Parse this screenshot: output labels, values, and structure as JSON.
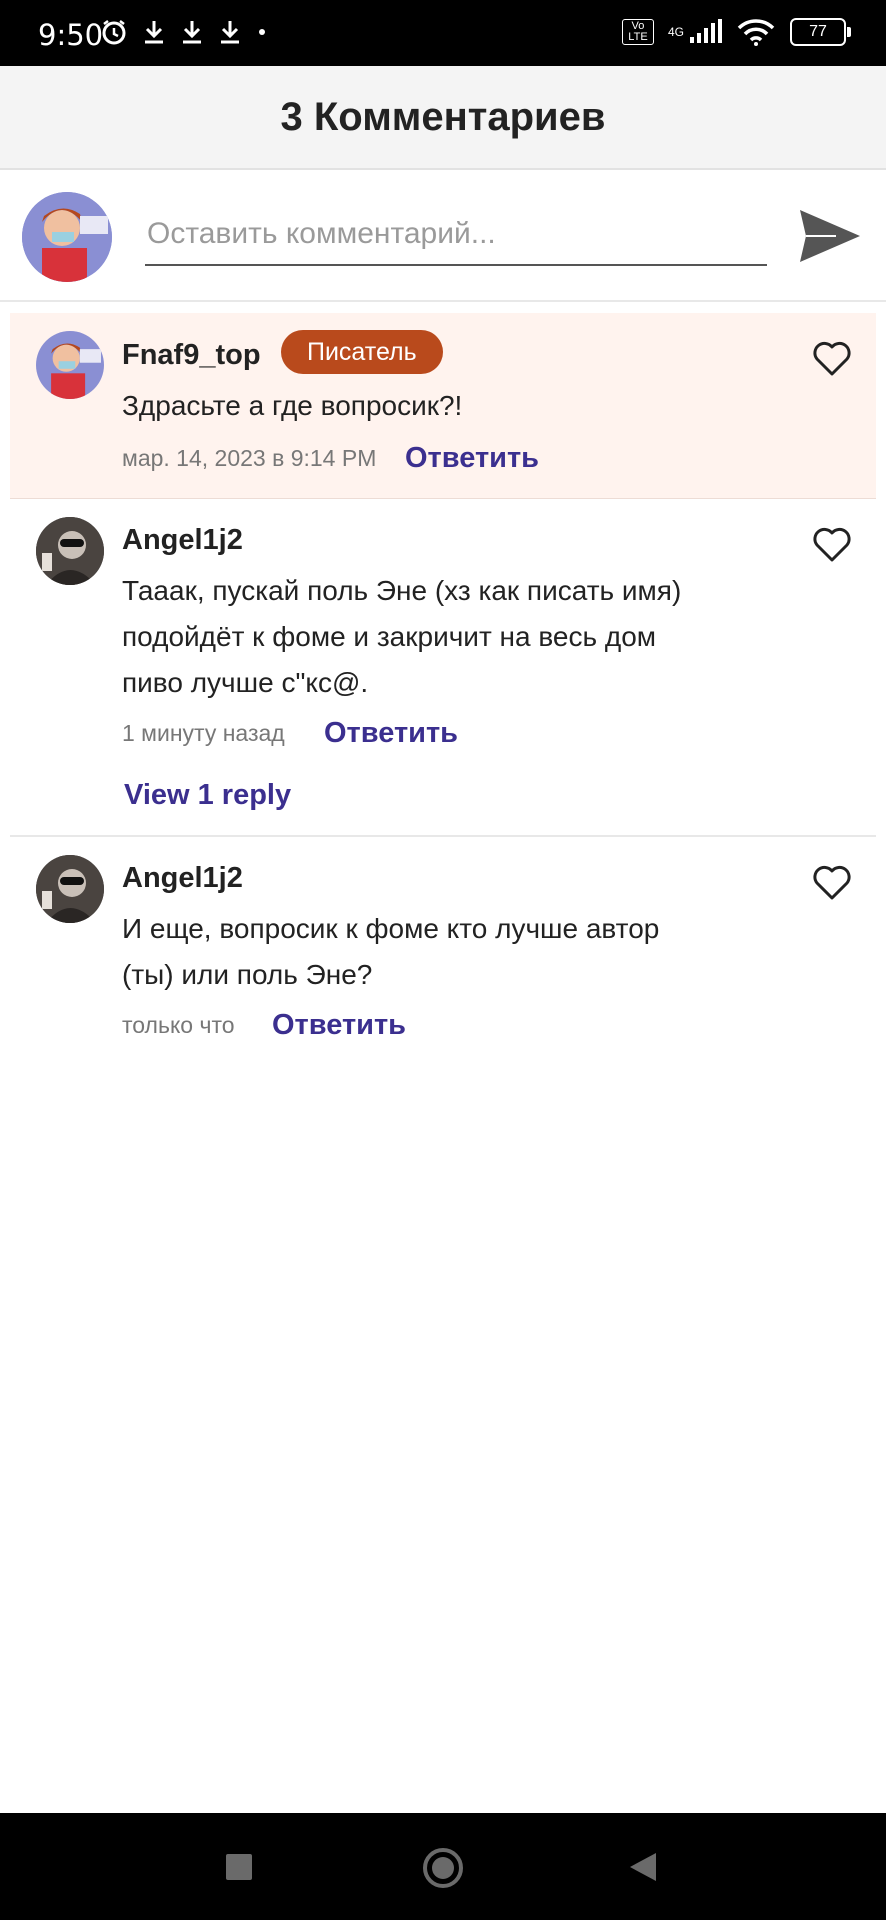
{
  "status_bar": {
    "time": "9:50",
    "network": "4G",
    "volte": "Vo LTE",
    "battery": "77"
  },
  "header": {
    "title": "3 Комментариев"
  },
  "compose": {
    "placeholder": "Оставить комментарий..."
  },
  "comments": [
    {
      "username": "Fnaf9_top",
      "badge": "Писатель",
      "text": "Здрасьте а где вопросик?!",
      "time": "мар. 14, 2023 в 9:14 PM",
      "reply_label": "Ответить"
    },
    {
      "username": "Angel1j2",
      "text_lines": [
        "Тааак, пускай поль Эне (хз как писать имя)",
        "подойдёт к фоме и закричит на весь дом",
        "пиво лучше с\"кс@."
      ],
      "time": "1 минуту назад",
      "reply_label": "Ответить",
      "view_replies": "View 1 reply"
    },
    {
      "username": "Angel1j2",
      "text_lines": [
        "И еще, вопросик к фоме кто лучше автор",
        "(ты) или поль Эне?"
      ],
      "time": "только что",
      "reply_label": "Ответить"
    }
  ],
  "colors": {
    "accent": "#3b2f8f",
    "badge": "#b94a1c",
    "highlight": "#fff3ee"
  }
}
